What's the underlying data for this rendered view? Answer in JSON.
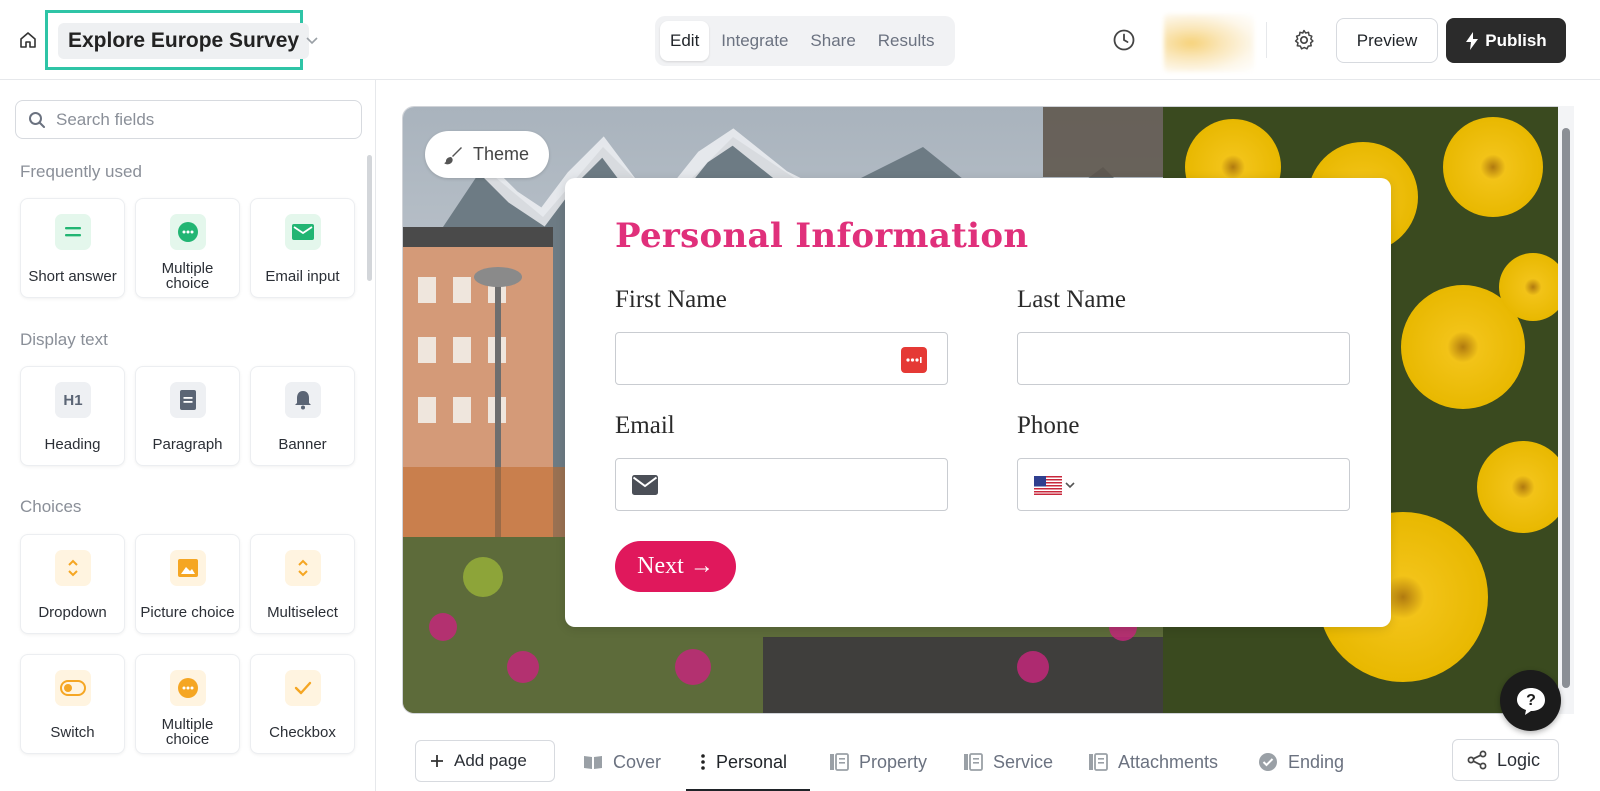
{
  "app": {
    "form_title": "Explore Europe Survey"
  },
  "header": {
    "modes": [
      "Edit",
      "Integrate",
      "Share",
      "Results"
    ],
    "active_mode": "Edit",
    "preview_label": "Preview",
    "publish_label": "Publish"
  },
  "sidebar": {
    "search_placeholder": "Search fields",
    "sections": [
      {
        "title": "Frequently used",
        "items": [
          {
            "label": "Short answer",
            "icon": "equals-icon",
            "color": "green"
          },
          {
            "label": "Multiple choice",
            "icon": "dots-circle-icon",
            "color": "green"
          },
          {
            "label": "Email input",
            "icon": "envelope-icon",
            "color": "green"
          }
        ]
      },
      {
        "title": "Display text",
        "items": [
          {
            "label": "Heading",
            "icon": "h1-icon",
            "color": "gray"
          },
          {
            "label": "Paragraph",
            "icon": "document-icon",
            "color": "gray"
          },
          {
            "label": "Banner",
            "icon": "bell-icon",
            "color": "gray"
          }
        ]
      },
      {
        "title": "Choices",
        "items": [
          {
            "label": "Dropdown",
            "icon": "updown-chevron-icon",
            "color": "orange"
          },
          {
            "label": "Picture choice",
            "icon": "image-icon",
            "color": "orange"
          },
          {
            "label": "Multiselect",
            "icon": "updown-chevron-icon",
            "color": "orange"
          },
          {
            "label": "Switch",
            "icon": "toggle-icon",
            "color": "orange"
          },
          {
            "label": "Multiple choice",
            "icon": "dots-circle-icon",
            "color": "orange"
          },
          {
            "label": "Checkbox",
            "icon": "check-icon",
            "color": "orange"
          }
        ]
      }
    ]
  },
  "canvas": {
    "theme_label": "Theme",
    "card": {
      "title": "Personal Information",
      "fields": {
        "first_name": "First Name",
        "last_name": "Last Name",
        "email": "Email",
        "phone": "Phone"
      },
      "next_label": "Next →"
    }
  },
  "pages": {
    "add_page_label": "Add page",
    "tabs": [
      {
        "label": "Cover",
        "icon": "book-icon"
      },
      {
        "label": "Personal",
        "icon": "drag-handle-icon",
        "active": true
      },
      {
        "label": "Property",
        "icon": "form-page-icon"
      },
      {
        "label": "Service",
        "icon": "form-page-icon"
      },
      {
        "label": "Attachments",
        "icon": "form-page-icon"
      },
      {
        "label": "Ending",
        "icon": "check-circle-icon"
      }
    ],
    "logic_label": "Logic"
  },
  "colors": {
    "accent_highlight": "#2ec4a6",
    "title_pink": "#e0307b",
    "next_button": "#e0185c",
    "publish_bg": "#2b2b2b"
  }
}
